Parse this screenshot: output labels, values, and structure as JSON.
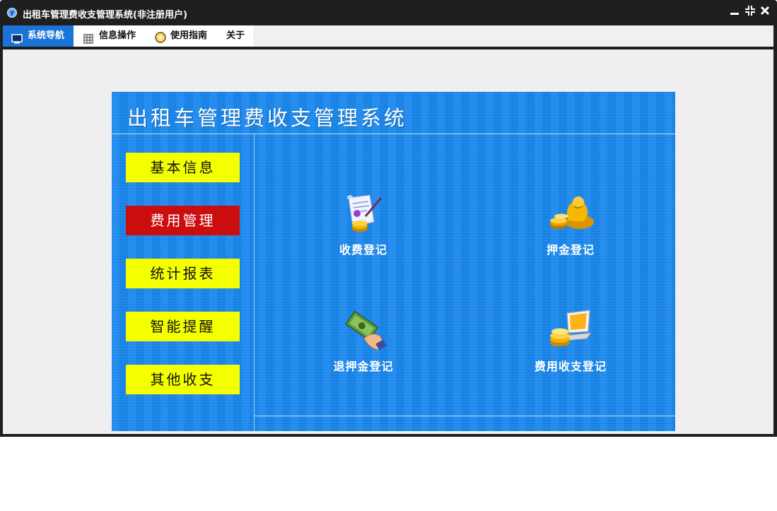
{
  "window": {
    "title": "出租车管理费收支管理系统(非注册用户)",
    "logo_text": "y",
    "controls": [
      "minimize-icon",
      "restore-icon",
      "close-icon"
    ]
  },
  "menu": {
    "items": [
      {
        "label": "系统导航",
        "icon": "monitor-icon",
        "active": true
      },
      {
        "label": "信息操作",
        "icon": "grid-icon",
        "active": false
      },
      {
        "label": "使用指南",
        "icon": "help-circle-icon",
        "active": false
      },
      {
        "label": "关于",
        "icon": "",
        "active": false
      }
    ]
  },
  "panel": {
    "title": "出租车管理费收支管理系统",
    "nav": [
      {
        "label": "基本信息",
        "selected": false
      },
      {
        "label": "费用管理",
        "selected": true
      },
      {
        "label": "统计报表",
        "selected": false
      },
      {
        "label": "智能提醒",
        "selected": false
      },
      {
        "label": "其他收支",
        "selected": false
      }
    ],
    "functions": [
      {
        "label": "收费登记",
        "icon": "receipt-scroll-icon"
      },
      {
        "label": "押金登记",
        "icon": "money-bag-icon"
      },
      {
        "label": "退押金登记",
        "icon": "cash-refund-icon"
      },
      {
        "label": "费用收支登记",
        "icon": "coins-laptop-icon"
      }
    ]
  },
  "colors": {
    "panel_blue": "#1f8df0",
    "nav_yellow": "#f4ff00",
    "nav_selected_red": "#cc0d0d",
    "menu_active_blue": "#1a73d6"
  }
}
